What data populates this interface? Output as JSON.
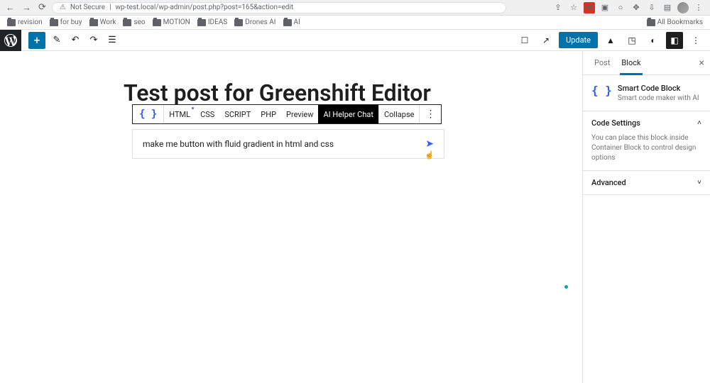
{
  "browser": {
    "security": "Not Secure",
    "url": "wp-test.local/wp-admin/post.php?post=165&action=edit"
  },
  "bookmarks": {
    "items": [
      {
        "label": "revision"
      },
      {
        "label": "for buy"
      },
      {
        "label": "Work"
      },
      {
        "label": "seo"
      },
      {
        "label": "MOTION"
      },
      {
        "label": "IDEAS"
      },
      {
        "label": "Drones AI"
      },
      {
        "label": "AI"
      }
    ],
    "all": "All Bookmarks"
  },
  "topbar": {
    "update": "Update"
  },
  "editor": {
    "post_title": "Test post for Greenshift Editor",
    "block_tabs": {
      "html": "HTML",
      "css": "CSS",
      "script": "SCRIPT",
      "php": "PHP",
      "preview": "Preview",
      "ai": "AI Helper Chat",
      "collapse": "Collapse"
    },
    "chat_prompt": "make me button with fluid gradient in html and css"
  },
  "sidebar": {
    "tabs": {
      "post": "Post",
      "block": "Block"
    },
    "block": {
      "title": "Smart Code Block",
      "subtitle": "Smart code maker with AI"
    },
    "panel1": {
      "title": "Code Settings",
      "body": "You can place this block inside Container Block to control design options"
    },
    "panel2": {
      "title": "Advanced"
    }
  }
}
